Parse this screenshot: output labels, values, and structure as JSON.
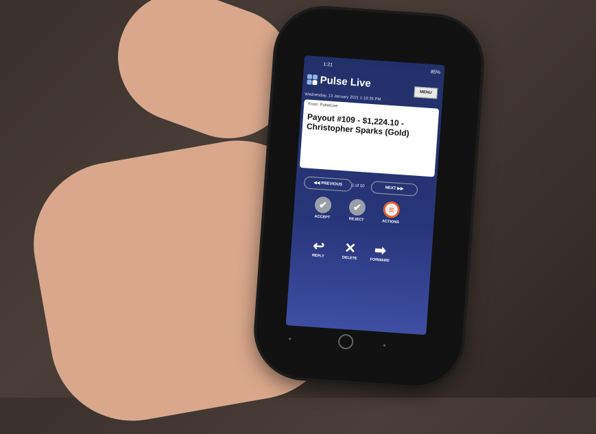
{
  "status": {
    "time": "1:21",
    "battery": "85%"
  },
  "app": {
    "name": "Pulse Live",
    "menu_label": "MENU"
  },
  "message": {
    "date": "Wednesday, 13 January 2021 1:18:35 PM",
    "from": "From: PulseLive",
    "subject": "Payout #109 - $1,224.10 - Christopher Sparks (Gold)"
  },
  "nav": {
    "previous": "PREVIOUS",
    "next": "NEXT",
    "count": "1 of 10"
  },
  "actions": {
    "accept": "ACCEPT",
    "reject": "REJECT",
    "actions": "ACTIONS"
  },
  "row2": {
    "reply": "REPLY",
    "delete": "DELETE",
    "forward": "FORWARD"
  },
  "icons": {
    "logo": "pulse-logo-icon",
    "accept": "check-icon",
    "reject": "check-icon",
    "actions": "menu-lines-icon",
    "reply": "reply-arrow-icon",
    "delete": "x-icon",
    "forward": "forward-arrow-icon"
  },
  "colors": {
    "header_bg": "#22306a",
    "accent": "#e8602c",
    "button_grey": "#9a9ea6"
  }
}
